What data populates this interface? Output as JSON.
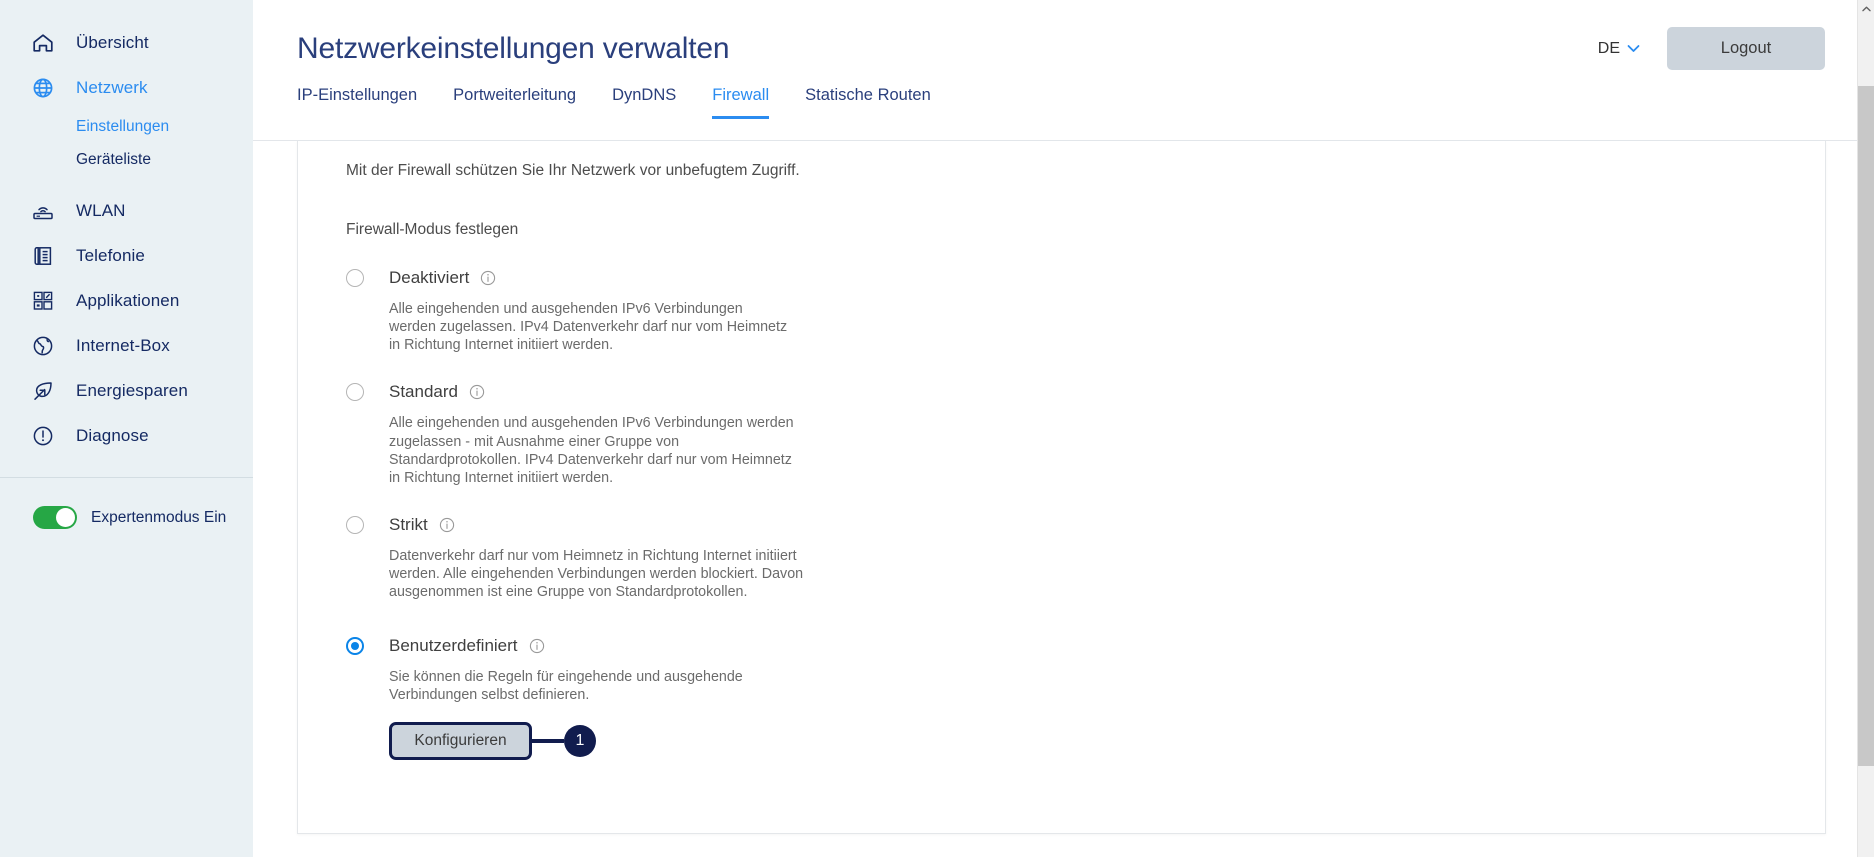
{
  "sidebar": {
    "items": [
      {
        "label": "Übersicht",
        "icon": "home-icon",
        "active": false
      },
      {
        "label": "Netzwerk",
        "icon": "globe-icon",
        "active": true
      },
      {
        "label": "WLAN",
        "icon": "wifi-router-icon",
        "active": false
      },
      {
        "label": "Telefonie",
        "icon": "phone-list-icon",
        "active": false
      },
      {
        "label": "Applikationen",
        "icon": "apps-grid-icon",
        "active": false
      },
      {
        "label": "Internet-Box",
        "icon": "internet-box-icon",
        "active": false
      },
      {
        "label": "Energiesparen",
        "icon": "leaf-energy-icon",
        "active": false
      },
      {
        "label": "Diagnose",
        "icon": "alert-circle-icon",
        "active": false
      }
    ],
    "subitems": [
      {
        "label": "Einstellungen",
        "active": true
      },
      {
        "label": "Geräteliste",
        "active": false
      }
    ],
    "expert_mode_label": "Expertenmodus Ein",
    "expert_mode_on": true,
    "colors": {
      "background": "#eaf1f4",
      "text": "#152a63",
      "active": "#2b8cf0",
      "toggle_on": "#26a745"
    }
  },
  "header": {
    "title": "Netzwerkeinstellungen verwalten",
    "language": "DE",
    "language_icon": "chevron-down-icon",
    "logout_label": "Logout"
  },
  "tabs": [
    {
      "label": "IP-Einstellungen",
      "active": false
    },
    {
      "label": "Portweiterleitung",
      "active": false
    },
    {
      "label": "DynDNS",
      "active": false
    },
    {
      "label": "Firewall",
      "active": true
    },
    {
      "label": "Statische Routen",
      "active": false
    }
  ],
  "content": {
    "intro": "Mit der Firewall schützen Sie Ihr Netzwerk vor unbefugtem Zugriff.",
    "section_label": "Firewall-Modus festlegen",
    "options": [
      {
        "title": "Deaktiviert",
        "selected": false,
        "description": "Alle eingehenden und ausgehenden IPv6 Verbindungen werden zugelassen. IPv4 Datenverkehr darf nur vom Heimnetz in Richtung Internet initiiert werden.",
        "info_icon": "info-circle-icon"
      },
      {
        "title": "Standard",
        "selected": false,
        "description": "Alle eingehenden und ausgehenden IPv6 Verbindungen werden zugelassen - mit Ausnahme einer Gruppe von Standardprotokollen. IPv4 Datenverkehr darf nur vom Heimnetz in Richtung Internet initiiert werden.",
        "info_icon": "info-circle-icon"
      },
      {
        "title": "Strikt",
        "selected": false,
        "description": "Datenverkehr darf nur vom Heimnetz in Richtung Internet initiiert werden. Alle eingehenden Verbindungen werden blockiert. Davon ausgenommen ist eine Gruppe von Standardprotokollen.",
        "info_icon": "info-circle-icon"
      },
      {
        "title": "Benutzerdefiniert",
        "selected": true,
        "description": "Sie können die Regeln für eingehende und ausgehende Verbindungen selbst definieren.",
        "info_icon": "info-circle-icon"
      }
    ],
    "configure_button": "Konfigurieren",
    "callout_number": "1",
    "callout_color": "#111c4e"
  },
  "scrollbar": {
    "arrow_icon": "caret-up-icon"
  }
}
